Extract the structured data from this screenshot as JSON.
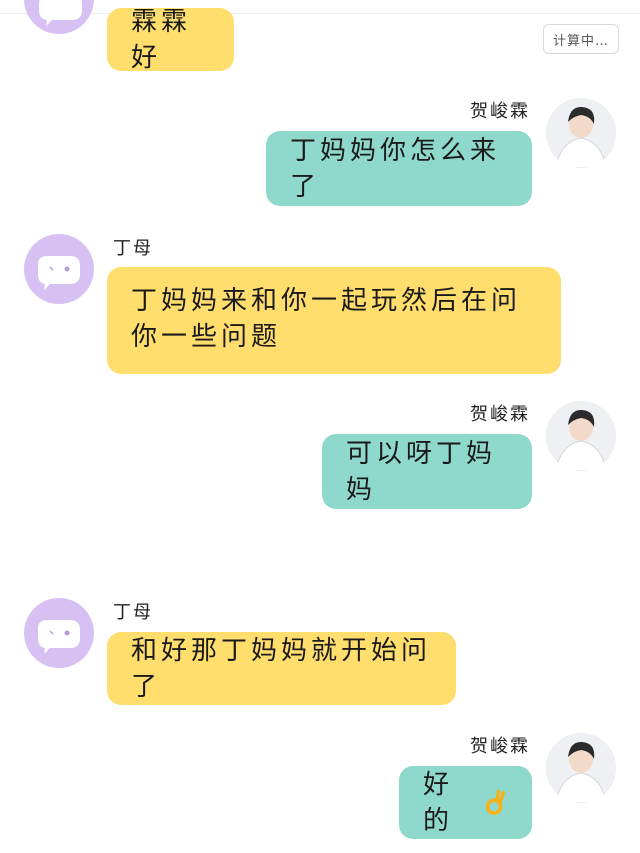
{
  "status": {
    "timer_label": "计算中…"
  },
  "colors": {
    "left_bubble": "#FFDE6E",
    "right_bubble": "#8FD9CC",
    "left_avatar": "#D7C1F3"
  },
  "messages": [
    {
      "side": "left",
      "sender": "",
      "text": "霖霖好"
    },
    {
      "side": "right",
      "sender": "贺峻霖",
      "text": "丁妈妈你怎么来了"
    },
    {
      "side": "left",
      "sender": "丁母",
      "text": "丁妈妈来和你一起玩然后在问你一些问题"
    },
    {
      "side": "right",
      "sender": "贺峻霖",
      "text": "可以呀丁妈妈"
    },
    {
      "side": "left",
      "sender": "丁母",
      "text": "和好那丁妈妈就开始问了"
    },
    {
      "side": "right",
      "sender": "贺峻霖",
      "text": "好的",
      "emoji": "ok-hand-icon"
    }
  ]
}
